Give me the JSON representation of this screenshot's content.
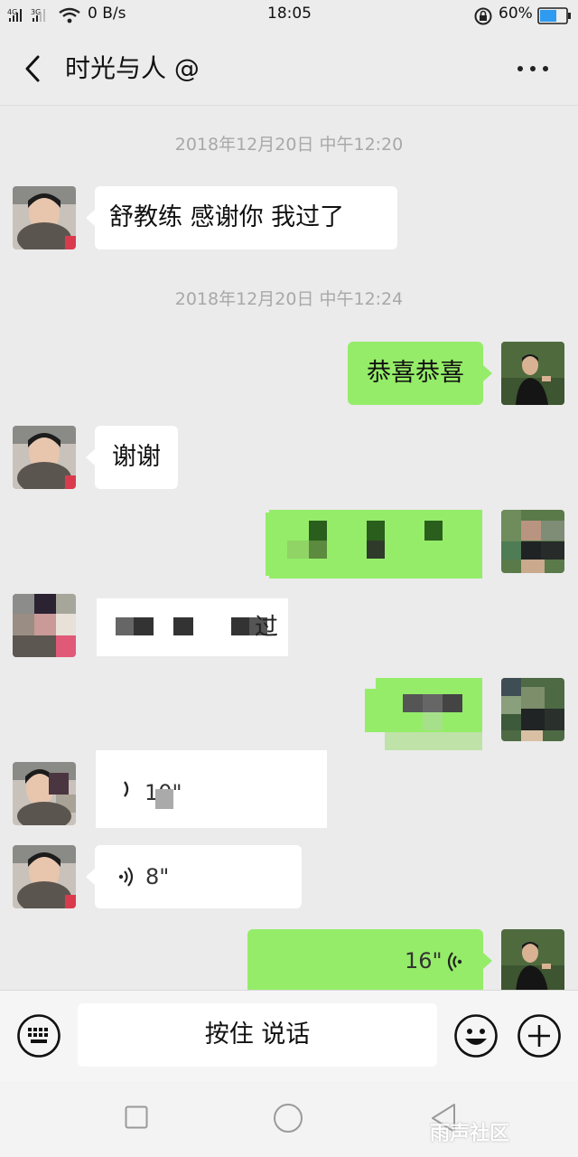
{
  "status_bar": {
    "network_left": "4G",
    "network_right": "3G",
    "speed": "0 B/s",
    "time": "18:05",
    "battery": "60%"
  },
  "header": {
    "title": "时光与人 @",
    "back_icon": "chevron-left-icon",
    "more_icon": "more-horizontal-icon"
  },
  "messages": [
    {
      "type": "timestamp",
      "text": "2018年12月20日 中午12:20"
    },
    {
      "type": "text",
      "side": "left",
      "text": "舒教练  感谢你  我过了"
    },
    {
      "type": "timestamp",
      "text": "2018年12月20日 中午12:24"
    },
    {
      "type": "text",
      "side": "right",
      "text": "恭喜恭喜"
    },
    {
      "type": "text",
      "side": "left",
      "text": "谢谢"
    },
    {
      "type": "text",
      "side": "right",
      "text": "",
      "pixelated": true
    },
    {
      "type": "text",
      "side": "left",
      "text": "过",
      "pixelated": true
    },
    {
      "type": "text",
      "side": "right",
      "text": "",
      "pixelated": true
    },
    {
      "type": "voice",
      "side": "left",
      "duration": "10\"",
      "pixelated": true
    },
    {
      "type": "voice",
      "side": "left",
      "duration": "8\""
    },
    {
      "type": "voice",
      "side": "right",
      "duration": "16\""
    }
  ],
  "input_bar": {
    "hold_to_talk": "按住 说话",
    "keyboard_icon": "keyboard-icon",
    "emoji_icon": "emoji-icon",
    "plus_icon": "plus-icon"
  },
  "nav_bar": {
    "square_icon": "recent-apps-icon",
    "circle_icon": "home-icon",
    "triangle_icon": "back-icon"
  },
  "watermark": "雨声社区",
  "colors": {
    "bg": "#ebebeb",
    "bubble_out": "#95ec69",
    "bubble_in": "#ffffff",
    "timestamp": "#a8a8a8"
  }
}
